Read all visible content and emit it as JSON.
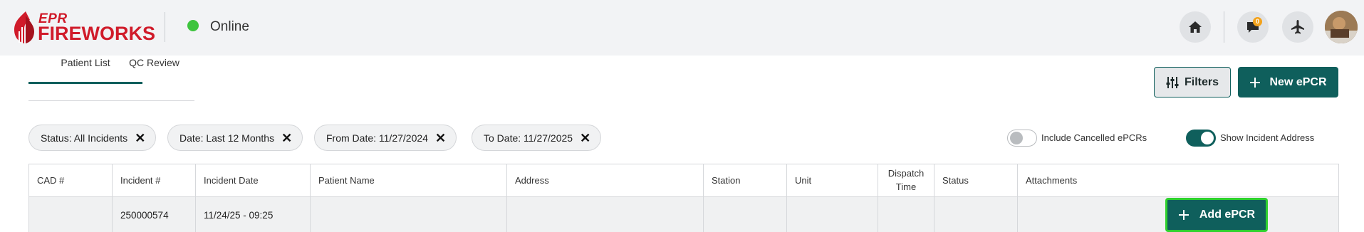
{
  "brand": {
    "line1": "EPR",
    "line2": "FIREWORKS",
    "color": "#d01b2a"
  },
  "status": {
    "label": "Online",
    "color": "#3ec43e"
  },
  "header_icons": [
    {
      "name": "home-icon"
    },
    {
      "name": "chat-icon",
      "badge": "0"
    },
    {
      "name": "airplane-icon"
    }
  ],
  "tabs": [
    {
      "label": "Patient List",
      "active": true
    },
    {
      "label": "QC Review",
      "active": false
    }
  ],
  "actions": {
    "filters_label": "Filters",
    "new_label": "New ePCR"
  },
  "filter_chips": [
    {
      "label": "Status: All Incidents"
    },
    {
      "label": "Date: Last 12 Months"
    },
    {
      "label": "From Date: 11/27/2024"
    },
    {
      "label": "To Date: 11/27/2025"
    }
  ],
  "toggles": [
    {
      "label": "Include Cancelled ePCRs",
      "on": false
    },
    {
      "label": "Show Incident Address",
      "on": true
    }
  ],
  "table": {
    "headers": [
      "CAD #",
      "Incident #",
      "Incident Date",
      "Patient Name",
      "Address",
      "Station",
      "Unit",
      "Dispatch\nTime",
      "Status",
      "Attachments"
    ],
    "dispatch_line1": "Dispatch",
    "dispatch_line2": "Time",
    "rows": [
      {
        "cad": "",
        "incident": "250000574",
        "date": "11/24/25 - 09:25",
        "patient": "",
        "address": "",
        "station": "",
        "unit": "",
        "dispatch": "",
        "status": "",
        "attachments": "",
        "action_label": "Add ePCR"
      }
    ]
  },
  "colors": {
    "primary": "#0f5f5c",
    "highlight": "#2ed12e",
    "badge": "#f3a21b"
  }
}
